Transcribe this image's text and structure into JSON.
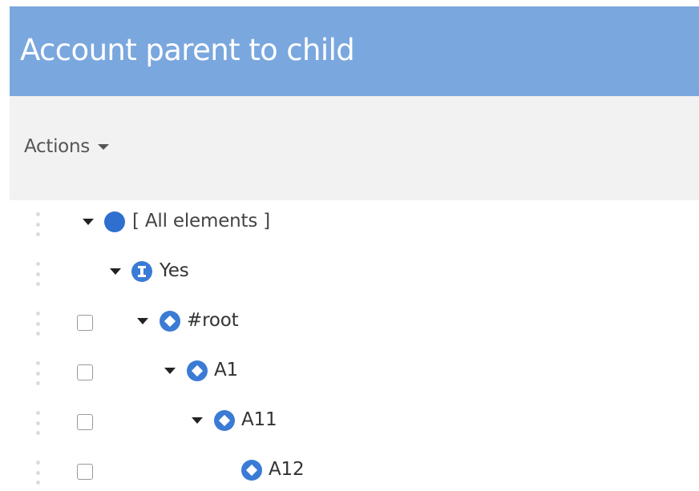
{
  "header": {
    "title": "Account parent to child"
  },
  "toolbar": {
    "actions_label": "Actions"
  },
  "tree": {
    "rows": [
      {
        "label": "[ All elements ]",
        "icon": "filled-circle-icon",
        "has_checkbox": false,
        "expanded": true
      },
      {
        "label": "Yes",
        "icon": "info-circle-icon",
        "has_checkbox": false,
        "expanded": true
      },
      {
        "label": "#root",
        "icon": "diamond-circle-icon",
        "has_checkbox": true,
        "expanded": true
      },
      {
        "label": "A1",
        "icon": "diamond-circle-icon",
        "has_checkbox": true,
        "expanded": true
      },
      {
        "label": "A11",
        "icon": "diamond-circle-icon",
        "has_checkbox": true,
        "expanded": true
      },
      {
        "label": "A12",
        "icon": "diamond-circle-icon",
        "has_checkbox": true,
        "expanded": false
      }
    ]
  },
  "colors": {
    "header_bg": "#7aa7de",
    "toolbar_bg": "#f2f2f2",
    "node_icon": "#3a7bd5"
  }
}
